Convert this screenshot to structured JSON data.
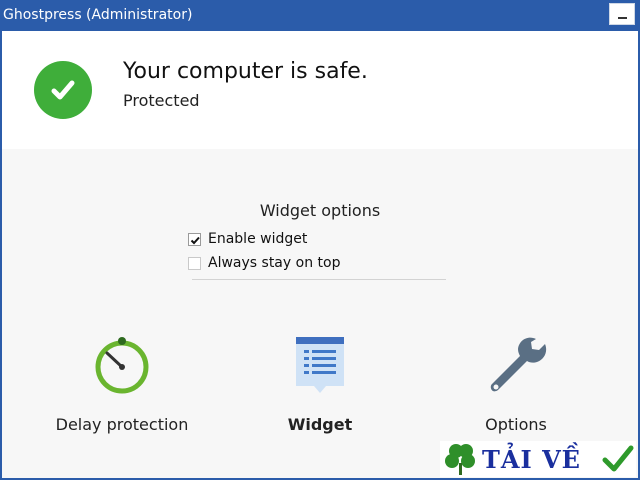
{
  "window": {
    "title": "Ghostpress (Administrator)",
    "minimize_label": "_"
  },
  "status": {
    "title": "Your computer is safe.",
    "subtitle": "Protected",
    "icon": "checkmark-icon",
    "color": "#3fae3a"
  },
  "widget_options": {
    "heading": "Widget options",
    "options": [
      {
        "label": "Enable widget",
        "checked": true
      },
      {
        "label": "Always stay on top",
        "checked": false
      }
    ]
  },
  "actions": [
    {
      "label": "Delay protection",
      "icon": "timer-gauge-icon",
      "active": false
    },
    {
      "label": "Widget",
      "icon": "widget-list-icon",
      "active": true
    },
    {
      "label": "Options",
      "icon": "wrench-icon",
      "active": false
    }
  ],
  "watermark": {
    "text": "TẢI VỀ",
    "icons": [
      "clover-icon",
      "checkmark-icon"
    ]
  },
  "colors": {
    "titlebar": "#2b5caa",
    "accent_green": "#3fae3a",
    "widget_blue": "#3f78c8",
    "wrench_gray": "#5a6f84"
  }
}
